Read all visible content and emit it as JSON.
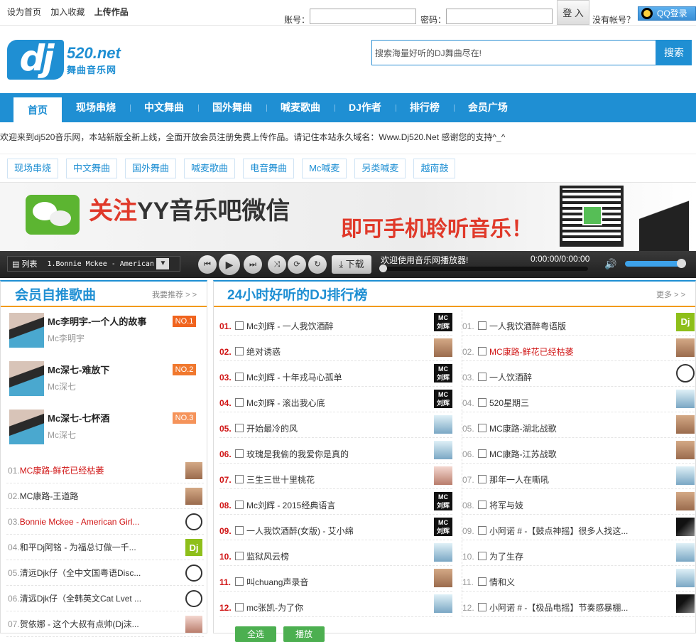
{
  "topbar": {
    "set_home": "设为首页",
    "add_fav": "加入收藏",
    "upload": "上传作品",
    "account_label": "账号：",
    "password_label": "密码：",
    "login_btn": "登 入",
    "no_account": "没有帐号？",
    "qq_login": "QQ登录"
  },
  "logo": {
    "main": "dj",
    "domain": "520.net",
    "subtitle": "舞曲音乐网"
  },
  "search": {
    "placeholder": "搜索海量好听的DJ舞曲尽在!",
    "button": "搜索"
  },
  "nav": [
    "首页",
    "现场串烧",
    "中文舞曲",
    "国外舞曲",
    "喊麦歌曲",
    "DJ作者",
    "排行榜",
    "会员广场"
  ],
  "welcome": "欢迎来到dj520音乐网，本站新版全新上线，全面开放会员注册免费上传作品。请记住本站永久域名：Www.Dj520.Net 感谢您的支持^_^",
  "categories": [
    "现场串烧",
    "中文舞曲",
    "国外舞曲",
    "喊麦歌曲",
    "电音舞曲",
    "Mc喊麦",
    "另类喊麦",
    "越南鼓"
  ],
  "banner": {
    "line1_red": "关注",
    "line1": "YY音乐吧微信",
    "line2": "即可手机聆听音乐！"
  },
  "player": {
    "list_label": "列表",
    "current": "1.Bonnie Mckee - American (",
    "download": "下载",
    "message": "欢迎使用音乐网播放器!",
    "time": "0:00:00/0:00:00"
  },
  "left": {
    "title": "会员自推歌曲",
    "more": "我要推荐 > >",
    "featured": [
      {
        "name": "Mc李明宇-一个人的故事",
        "sub": "Mc李明宇",
        "rank": "NO.1",
        "color": "#f0641e"
      },
      {
        "name": "Mc深七-难放下",
        "sub": "Mc深七",
        "rank": "NO.2",
        "color": "#f0782e"
      },
      {
        "name": "Mc深七-七杯酒",
        "sub": "Mc深七",
        "rank": "NO.3",
        "color": "#f5935a"
      }
    ],
    "list": [
      {
        "num": "01.",
        "title": "MC康路-鲜花已经枯萎",
        "red": true,
        "thumb": "man1"
      },
      {
        "num": "02.",
        "title": "MC康路-王道路",
        "red": false,
        "thumb": "man1"
      },
      {
        "num": "03.",
        "title": "Bonnie Mckee - American Girl...",
        "red": true,
        "thumb": "hp"
      },
      {
        "num": "04.",
        "title": "和平Dj阿铭 - 为福总订做一千...",
        "red": false,
        "thumb": "dj"
      },
      {
        "num": "05.",
        "title": "清远Djk仔（全中文国粤语Disc...",
        "red": false,
        "thumb": "hp"
      },
      {
        "num": "06.",
        "title": "清远Djk仔（全韩英文Cat Lvet ...",
        "red": false,
        "thumb": "hp"
      },
      {
        "num": "07.",
        "title": "贺依娜 - 这个大叔有点帅(Dj沫...",
        "red": false,
        "thumb": "girl"
      }
    ]
  },
  "right": {
    "title": "24小时好听的DJ排行榜",
    "more": "更多 > >",
    "col1": [
      {
        "num": "01.",
        "title": "Mc刘辉 - 一人我饮酒醉",
        "thumb": "mc"
      },
      {
        "num": "02.",
        "title": "绝对诱惑",
        "thumb": "man1"
      },
      {
        "num": "03.",
        "title": "Mc刘辉 - 十年戎马心孤单",
        "thumb": "mc"
      },
      {
        "num": "04.",
        "title": "Mc刘辉 - 滚出我心底",
        "thumb": "mc"
      },
      {
        "num": "05.",
        "title": "开始最冷的风",
        "thumb": "sky"
      },
      {
        "num": "06.",
        "title": "玫瑰是我偷的我爱你是真的",
        "thumb": "sky"
      },
      {
        "num": "07.",
        "title": "三生三世十里桃花",
        "thumb": "girl"
      },
      {
        "num": "08.",
        "title": "Mc刘辉 - 2015经典语言",
        "thumb": "mc"
      },
      {
        "num": "09.",
        "title": "一人我饮酒醉(女版) - 艾小绵",
        "thumb": "mc"
      },
      {
        "num": "10.",
        "title": "监狱风云榜",
        "thumb": "sky"
      },
      {
        "num": "11.",
        "title": "叫chuang声录音",
        "thumb": "man1"
      },
      {
        "num": "12.",
        "title": "mc张凯-为了你",
        "thumb": "sky"
      }
    ],
    "col2": [
      {
        "num": "01.",
        "title": "一人我饮酒醉粤语版",
        "red": false,
        "thumb": "dj"
      },
      {
        "num": "02.",
        "title": "MC康路-鲜花已经枯萎",
        "red": true,
        "thumb": "man1"
      },
      {
        "num": "03.",
        "title": "一人饮酒醉",
        "red": false,
        "thumb": "hp"
      },
      {
        "num": "04.",
        "title": "520星期三",
        "red": false,
        "thumb": "sky"
      },
      {
        "num": "05.",
        "title": "MC康路-湖北战歌",
        "red": false,
        "thumb": "man1"
      },
      {
        "num": "06.",
        "title": "MC康路-江苏战歌",
        "red": false,
        "thumb": "man1"
      },
      {
        "num": "07.",
        "title": "那年一人在嘶吼",
        "red": false,
        "thumb": "sky"
      },
      {
        "num": "08.",
        "title": "将军与妓",
        "red": false,
        "thumb": "man1"
      },
      {
        "num": "09.",
        "title": "小阿诺 # -【鼓点神摇】很多人找这...",
        "red": false,
        "thumb": "bw"
      },
      {
        "num": "10.",
        "title": "为了生存",
        "red": false,
        "thumb": "sky"
      },
      {
        "num": "11.",
        "title": "情和义",
        "red": false,
        "thumb": "sky"
      },
      {
        "num": "12.",
        "title": "小阿诺 # -【极品电摇】节奏感暴棚...",
        "red": false,
        "thumb": "bw"
      }
    ],
    "select_all": "全选",
    "play": "播放"
  },
  "colors": {
    "brand": "#1f8fd3",
    "accent": "#f29a0a",
    "red": "#d01515"
  }
}
